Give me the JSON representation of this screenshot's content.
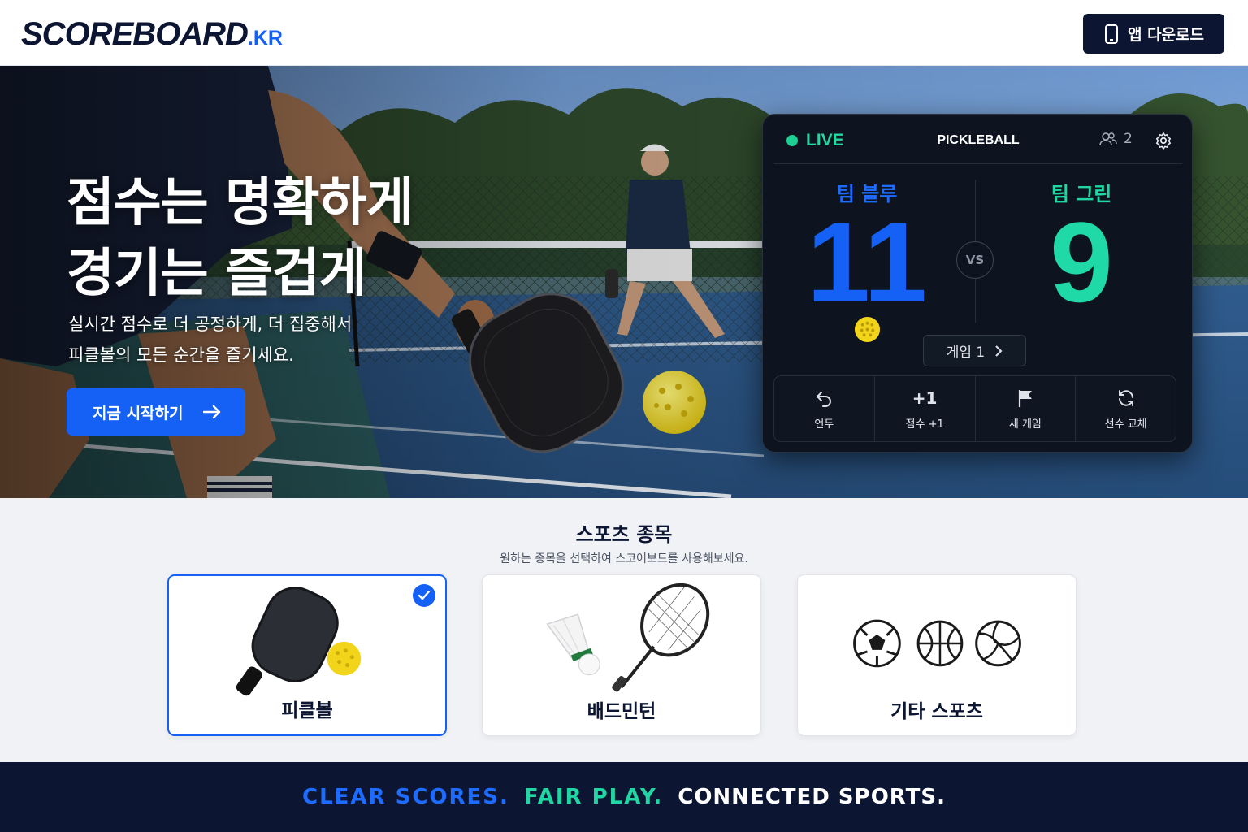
{
  "header": {
    "logo_main": "SCOREBOARD",
    "logo_suffix": ".KR",
    "download_label": "앱 다운로드",
    "download_icon": "smartphone-icon"
  },
  "hero": {
    "title_line1": "점수는 명확하게",
    "title_line2": "경기는 즐겁게",
    "subtitle_line1": "실시간 점수로 더 공정하게, 더 집중해서",
    "subtitle_line2": "피클볼의 모든 순간을 즐기세요.",
    "cta_label": "지금 시작하기",
    "cta_icon": "arrow-right-icon"
  },
  "scoreboard": {
    "live_label": "LIVE",
    "sport_label": "PICKLEBALL",
    "players_count": "2",
    "team_a": {
      "name": "팀 블루",
      "score": "11",
      "serving": true
    },
    "team_b": {
      "name": "팀 그린",
      "score": "9",
      "serving": false
    },
    "vs_label": "VS",
    "game_label": "게임 1",
    "actions": [
      {
        "label": "언두",
        "icon": "undo-icon"
      },
      {
        "label": "점수 +1",
        "icon_text": "+1"
      },
      {
        "label": "새 게임",
        "icon": "flag-icon"
      },
      {
        "label": "선수 교체",
        "icon": "refresh-icon"
      }
    ]
  },
  "sports": {
    "title": "스포츠 종목",
    "subtitle": "원하는 종목을 선택하여 스코어보드를 사용해보세요.",
    "cards": [
      {
        "label": "피클볼",
        "selected": true
      },
      {
        "label": "배드민턴",
        "selected": false
      },
      {
        "label": "기타 스포츠",
        "selected": false
      }
    ]
  },
  "tagline": {
    "part1": "CLEAR SCORES.",
    "part2": "FAIR PLAY.",
    "part3": "CONNECTED SPORTS."
  },
  "colors": {
    "navy": "#0c1633",
    "blue": "#1560f5",
    "green": "#20d6a2",
    "ball_yellow": "#f2d41a"
  }
}
